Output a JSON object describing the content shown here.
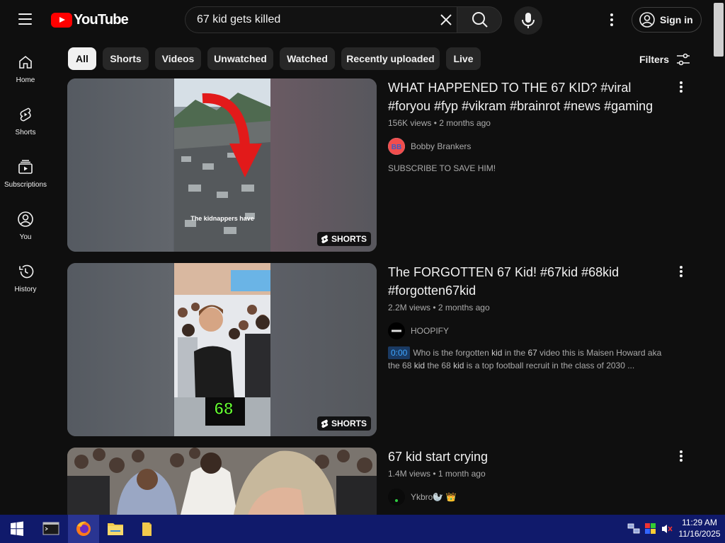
{
  "brand": {
    "logo_text": "YouTube",
    "accent": "#ff0000"
  },
  "search": {
    "value": "67 kid gets killed"
  },
  "header": {
    "signin_label": "Sign in"
  },
  "sidebar": {
    "items": [
      {
        "label": "Home",
        "icon": "home-icon"
      },
      {
        "label": "Shorts",
        "icon": "shorts-icon"
      },
      {
        "label": "Subscriptions",
        "icon": "subscriptions-icon"
      },
      {
        "label": "You",
        "icon": "you-icon"
      },
      {
        "label": "History",
        "icon": "history-icon"
      }
    ]
  },
  "chips": [
    "All",
    "Shorts",
    "Videos",
    "Unwatched",
    "Watched",
    "Recently uploaded",
    "Live"
  ],
  "active_chip": "All",
  "filters_label": "Filters",
  "results": [
    {
      "title": "WHAT HAPPENED TO THE 67 KID? #viral #foryou #fyp #vikram #brainrot #news #gaming",
      "views": "156K views",
      "age": "2 months ago",
      "channel": "Bobby Brankers",
      "description": "SUBSCRIBE TO SAVE HIM!",
      "badge": "SHORTS",
      "thumb_caption": "The kidnappers have"
    },
    {
      "title": "The FORGOTTEN 67 Kid! #67kid #68kid #forgotten67kid",
      "views": "2.2M views",
      "age": "2 months ago",
      "channel": "HOOPIFY",
      "timestamp": "0:00",
      "description_parts": [
        "Who is the forgotten ",
        "kid",
        " in the ",
        "67",
        " video this is Maisen Howard aka the 68 ",
        "kid",
        " the 68 ",
        "kid",
        " is a top football recruit in the class of 2030 ..."
      ],
      "badge": "SHORTS",
      "thumb_caption": "68"
    },
    {
      "title": "67 kid start crying",
      "views": "1.4M views",
      "age": "1 month ago",
      "channel": "Ykbro🦭 👑"
    }
  ],
  "taskbar": {
    "time": "11:29 AM",
    "date": "11/16/2025"
  }
}
